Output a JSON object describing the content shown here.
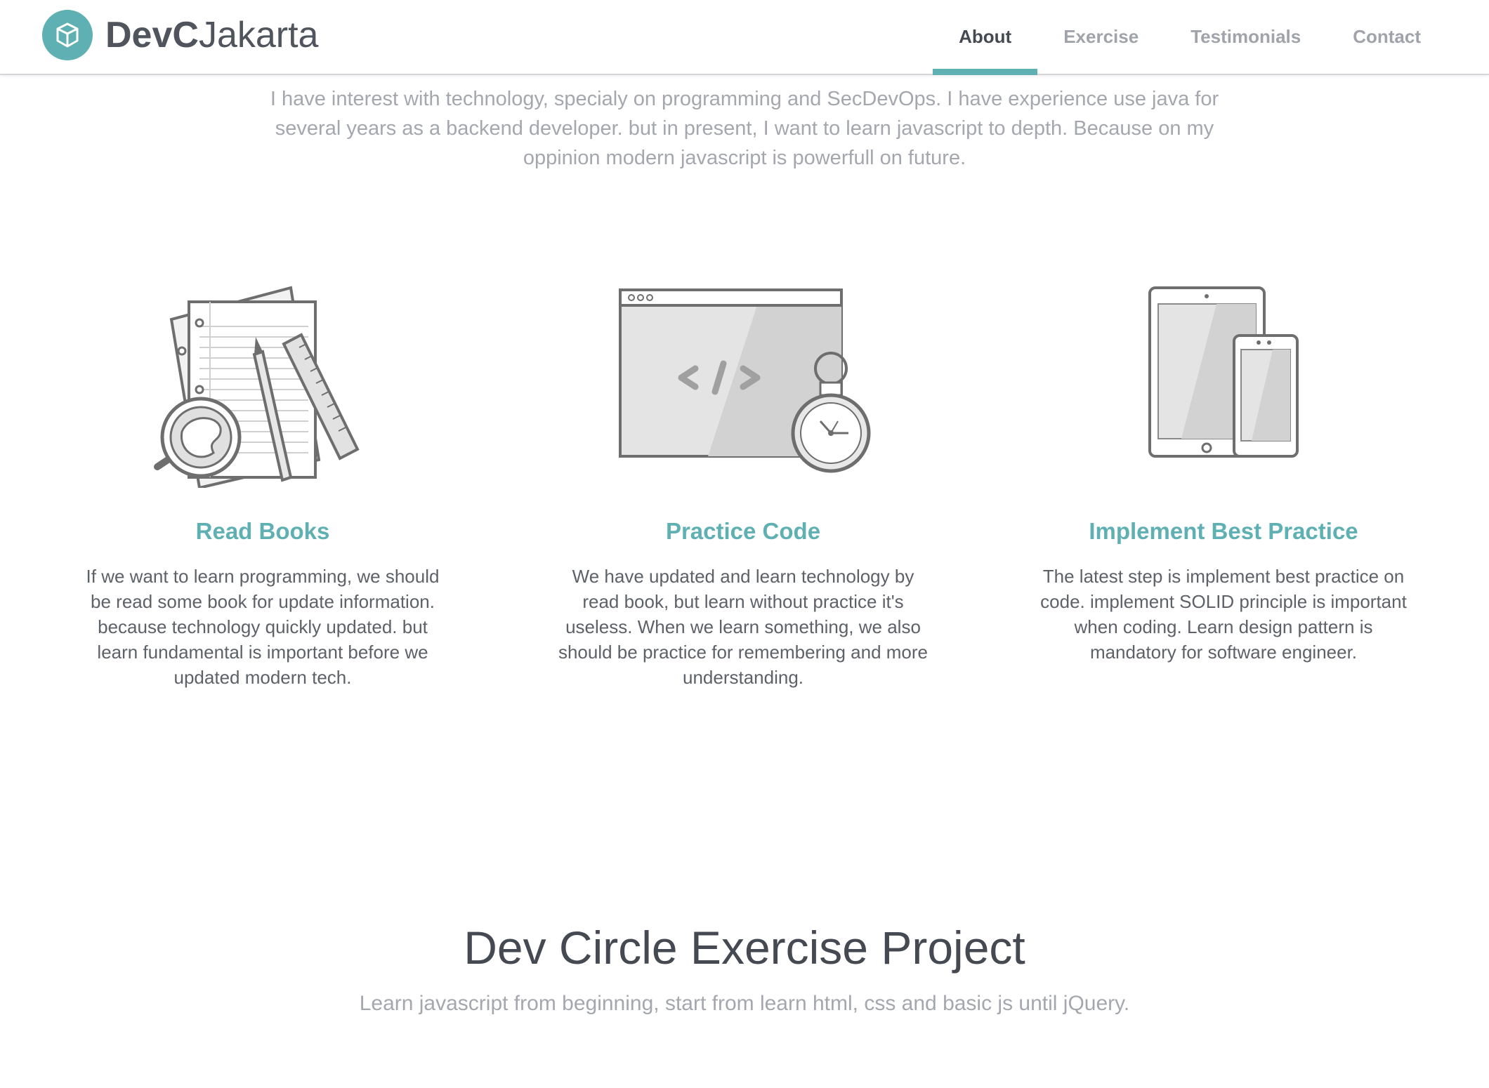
{
  "brand": {
    "name_strong": "DevC",
    "name_rest": "Jakarta",
    "logo_icon": "cube-icon"
  },
  "nav": {
    "items": [
      {
        "label": "About",
        "active": true
      },
      {
        "label": "Exercise",
        "active": false
      },
      {
        "label": "Testimonials",
        "active": false
      },
      {
        "label": "Contact",
        "active": false
      }
    ]
  },
  "intro": {
    "text": "I have interest with technology, specialy on programming and SecDevOps. I have experience use java for several years as a backend developer. but in present, I want to learn javascript to depth. Because on my oppinion modern javascript is powerfull on future."
  },
  "features": [
    {
      "title": "Read Books",
      "icon": "books-magnifier-icon",
      "text": "If we want to learn programming, we should be read some book for update information. because technology quickly updated. but learn fundamental is important before we updated modern tech."
    },
    {
      "title": "Practice Code",
      "icon": "code-window-stopwatch-icon",
      "text": "We have updated and learn technology by read book, but learn without practice it's useless. When we learn something, we also should be practice for remembering and more understanding."
    },
    {
      "title": "Implement Best Practice",
      "icon": "tablet-phone-icon",
      "text": "The latest step is implement best practice on code. implement SOLID principle is important when coding. Learn design pattern is mandatory for software engineer."
    }
  ],
  "exercise": {
    "title": "Dev Circle Exercise Project",
    "subtitle": "Learn javascript from beginning, start from learn html, css and basic js until jQuery."
  },
  "colors": {
    "accent": "#5fb0b3",
    "heading": "#454a52",
    "muted": "#a4a8ae"
  }
}
